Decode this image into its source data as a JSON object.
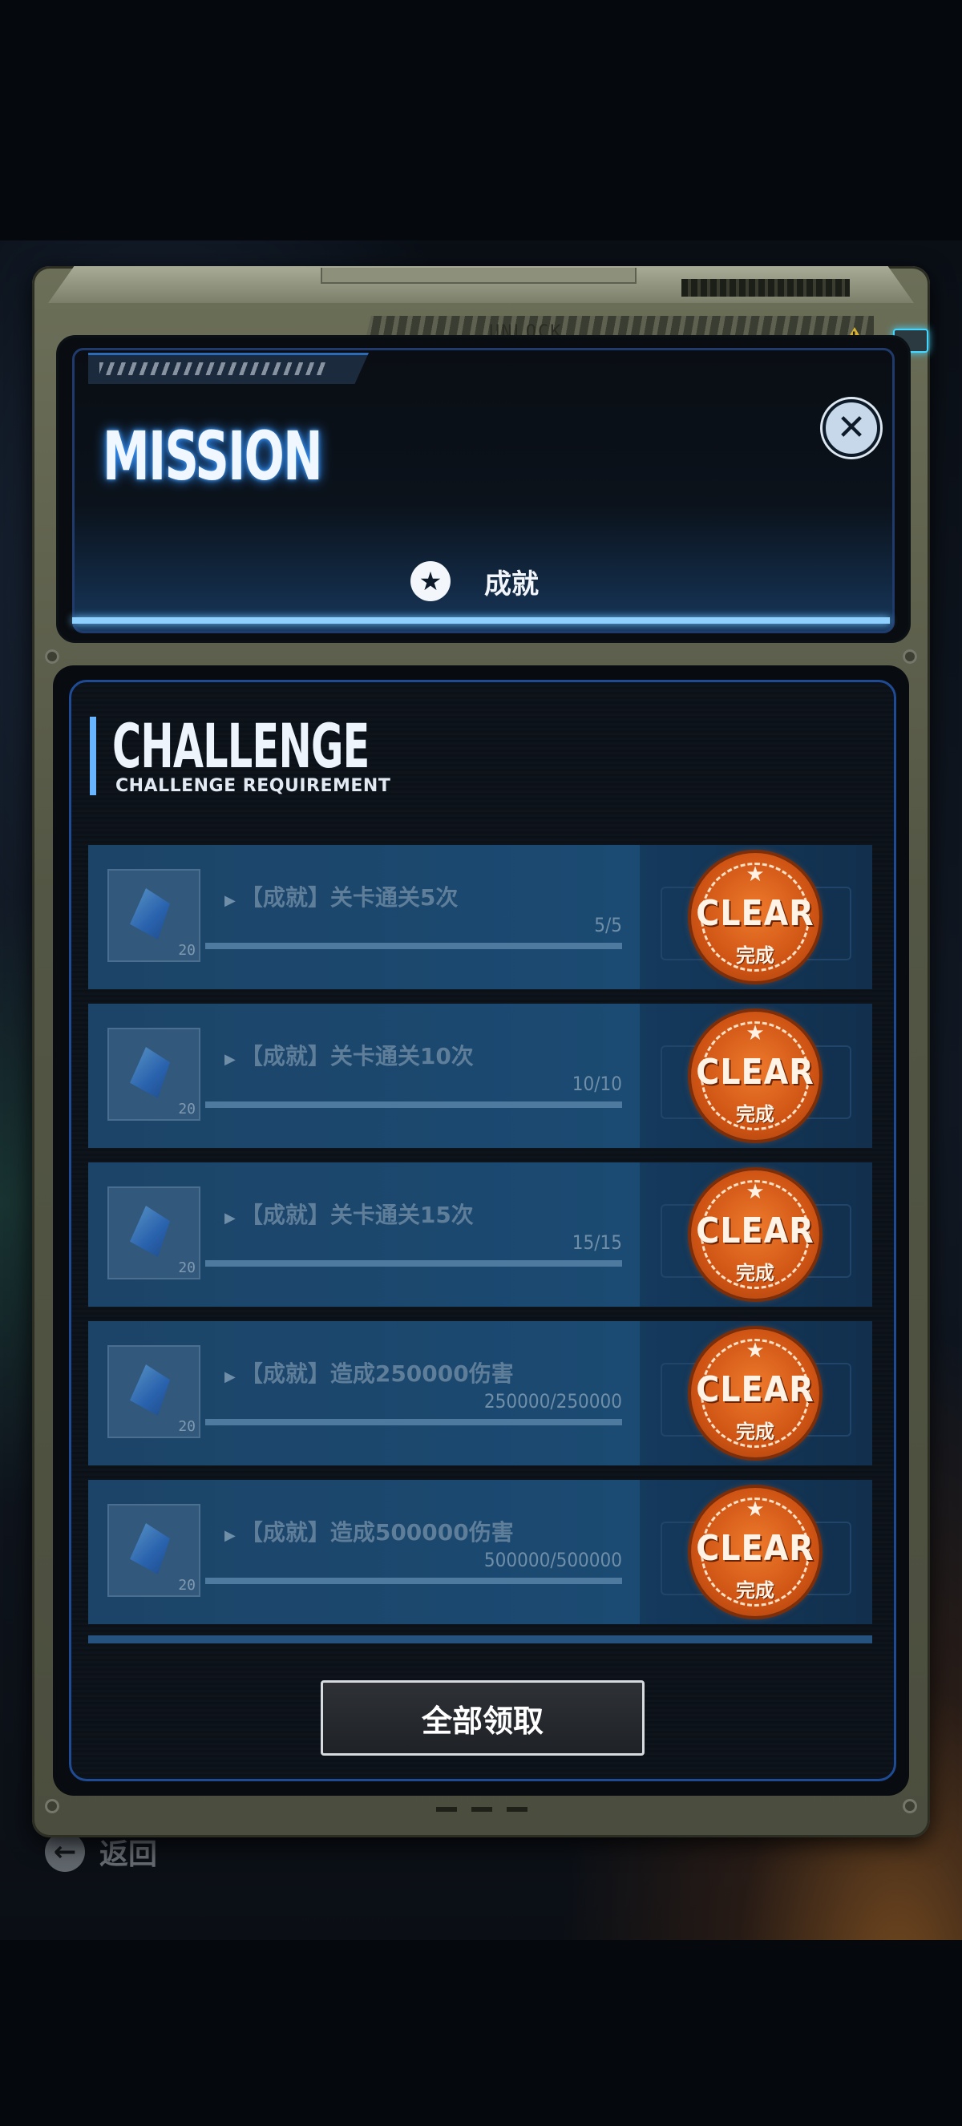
{
  "header": {
    "title": "MISSION",
    "frame_text": "UNLOCK",
    "tab_label": "成就",
    "tab_icon": "star-icon",
    "close_icon": "close-icon"
  },
  "challenge": {
    "title": "CHALLENGE",
    "subtitle": "CHALLENGE REQUIREMENT"
  },
  "tasks": [
    {
      "name": "【成就】关卡通关5次",
      "progress": "5/5",
      "reward_count": "20",
      "stamp": "CLEAR",
      "stamp_sub": "完成"
    },
    {
      "name": "【成就】关卡通关10次",
      "progress": "10/10",
      "reward_count": "20",
      "stamp": "CLEAR",
      "stamp_sub": "完成"
    },
    {
      "name": "【成就】关卡通关15次",
      "progress": "15/15",
      "reward_count": "20",
      "stamp": "CLEAR",
      "stamp_sub": "完成"
    },
    {
      "name": "【成就】造成250000伤害",
      "progress": "250000/250000",
      "reward_count": "20",
      "stamp": "CLEAR",
      "stamp_sub": "完成"
    },
    {
      "name": "【成就】造成500000伤害",
      "progress": "500000/500000",
      "reward_count": "20",
      "stamp": "CLEAR",
      "stamp_sub": "完成"
    }
  ],
  "claim_all_label": "全部领取",
  "back_label": "返回",
  "colors": {
    "accent_blue": "#68b4ff",
    "stamp_orange": "#cf5414",
    "frame_olive": "#535644"
  }
}
